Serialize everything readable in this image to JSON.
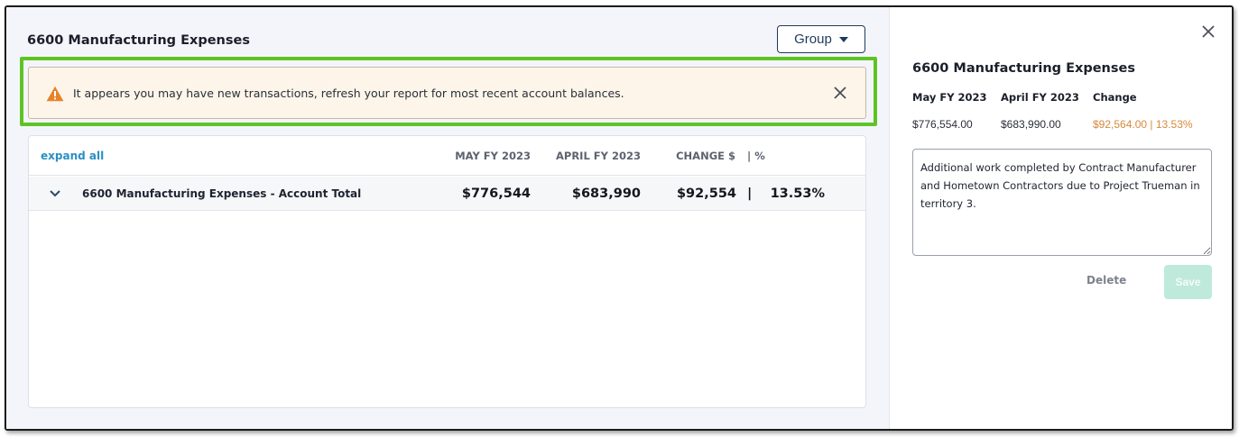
{
  "main": {
    "title": "6600 Manufacturing Expenses",
    "group_button": {
      "label": "Group"
    },
    "alert": {
      "message": "It appears you may have new transactions, refresh your report for most recent account balances.",
      "icon": "warning-triangle-icon",
      "icon_color": "#e8822a"
    },
    "table": {
      "expand_all": "expand all",
      "columns": {
        "may": "MAY FY 2023",
        "april": "APRIL FY 2023",
        "change": "CHANGE $",
        "pct": "| %"
      },
      "rows": [
        {
          "label": "6600 Manufacturing Expenses - Account Total",
          "may": "$776,544",
          "april": "$683,990",
          "change": "$92,554",
          "sep": "|",
          "pct": "13.53%"
        }
      ]
    }
  },
  "panel": {
    "title": "6600 Manufacturing Expenses",
    "headers": {
      "may": "May FY 2023",
      "april": "April FY 2023",
      "change": "Change"
    },
    "values": {
      "may": "$776,554.00",
      "april": "$683,990.00",
      "change": "$92,564.00 | 13.53%"
    },
    "note": "Additional work completed by Contract Manufacturer and Hometown Contractors due to Project Trueman in territory 3.",
    "delete_label": "Delete",
    "save_label": "Save"
  },
  "colors": {
    "highlight": "#5ec424",
    "link": "#2a8fc3",
    "change_value": "#d6893b",
    "save_disabled": "#bfeadb"
  }
}
